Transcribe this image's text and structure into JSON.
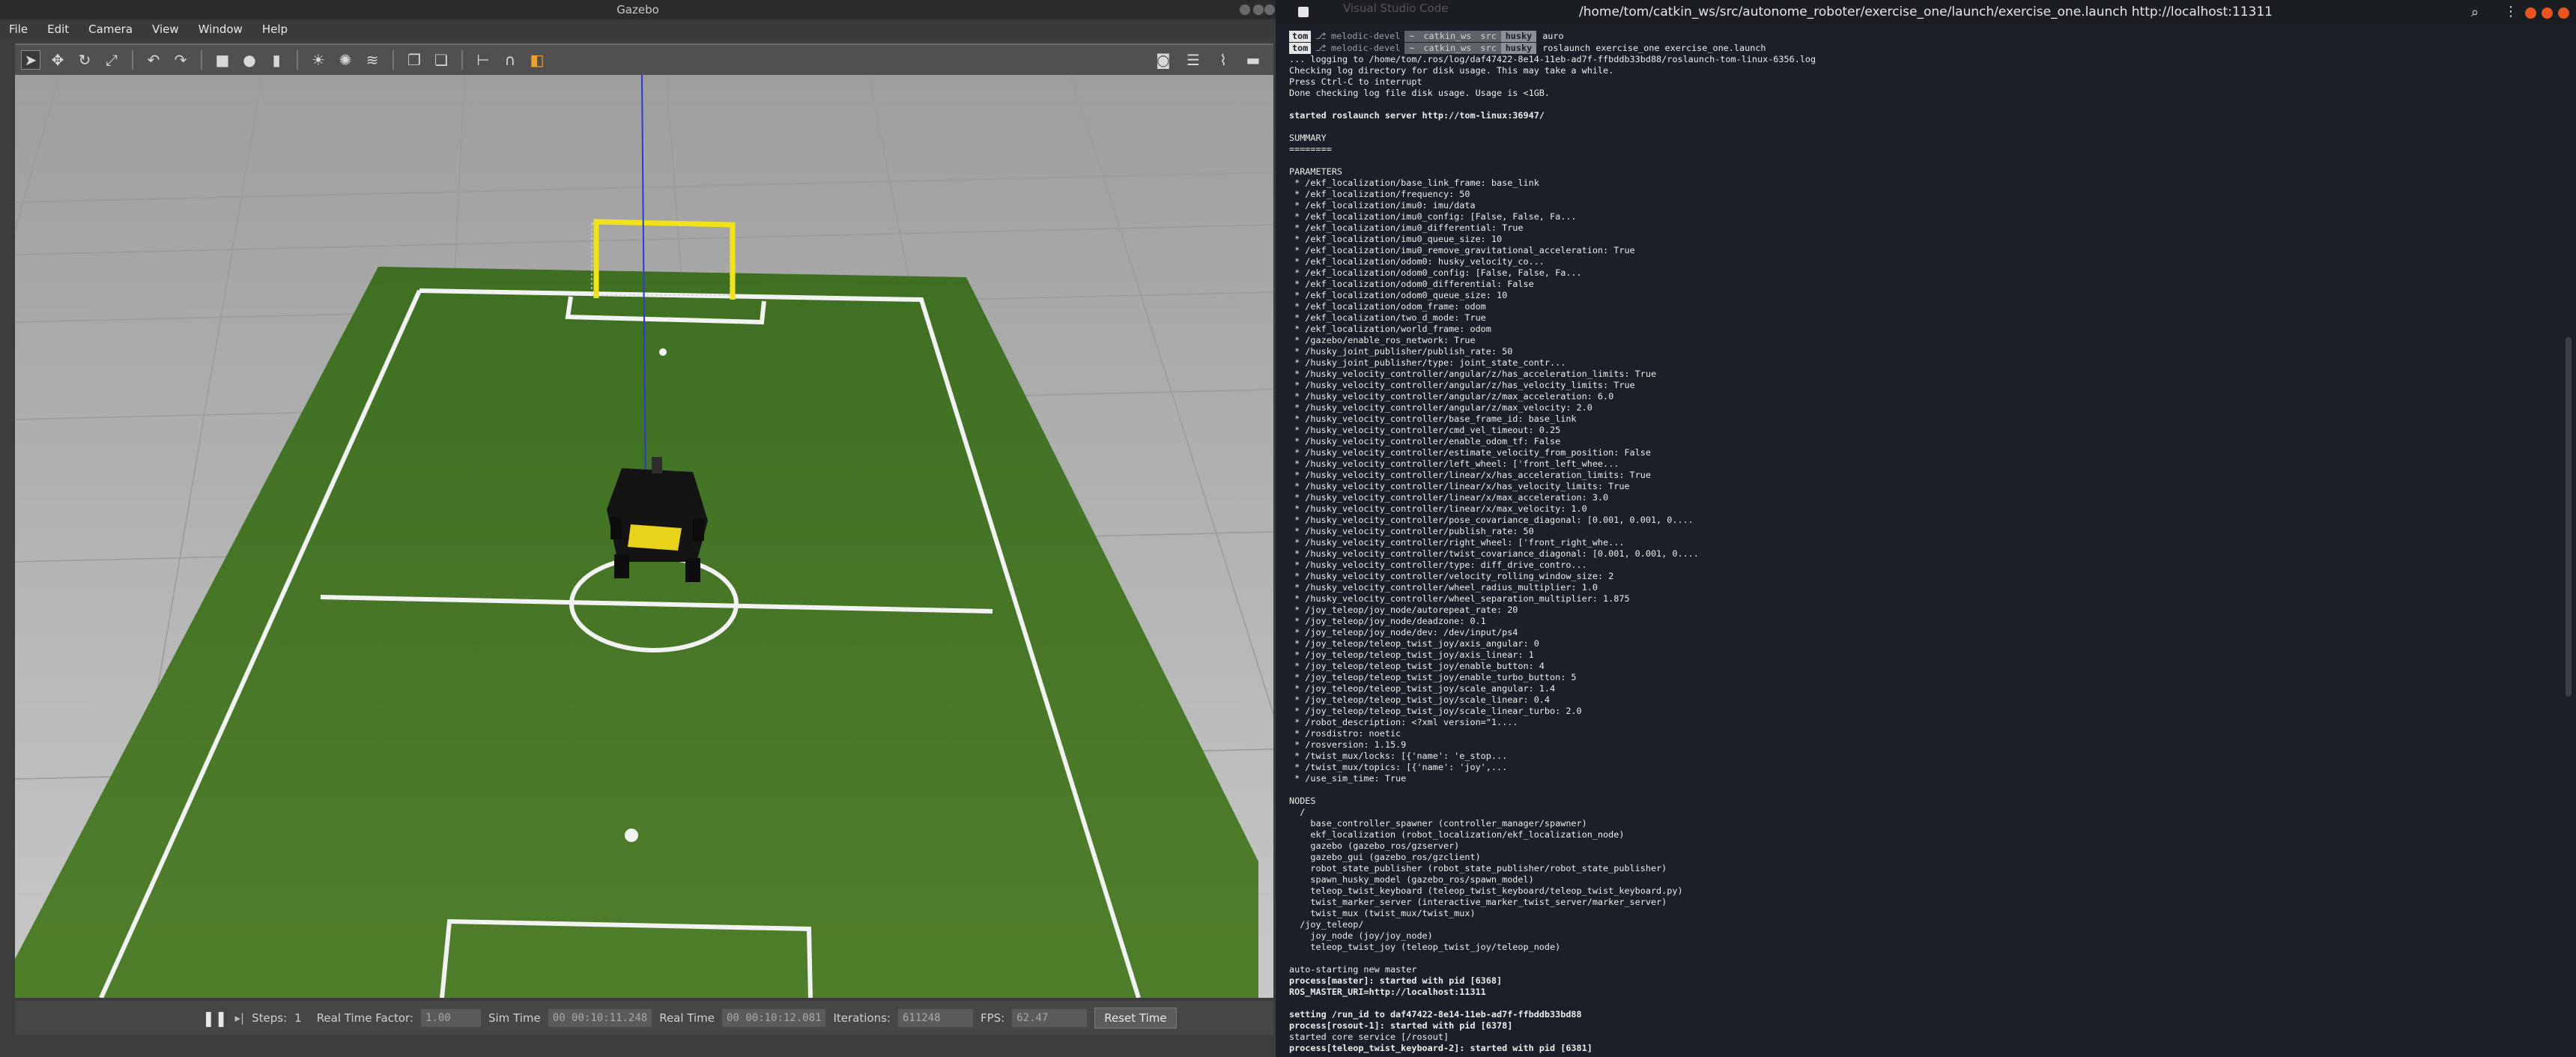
{
  "gazebo": {
    "title": "Gazebo",
    "menu": [
      "File",
      "Edit",
      "Camera",
      "View",
      "Window",
      "Help"
    ],
    "bottom": {
      "steps_label": "Steps:",
      "steps_value": "1",
      "rtf_label": "Real Time Factor:",
      "rtf_value": "1.00",
      "simtime_label": "Sim Time",
      "simtime_value": "00 00:10:11.248",
      "realtime_label": "Real Time",
      "realtime_value": "00 00:10:12.081",
      "iterations_label": "Iterations:",
      "iterations_value": "611248",
      "fps_label": "FPS:",
      "fps_value": "62.47",
      "reset_label": "Reset Time"
    }
  },
  "terminal": {
    "faded_title": "Visual Studio Code",
    "title": "/home/tom/catkin_ws/src/autonome_roboter/exercise_one/launch/exercise_one.launch http://localhost:11311",
    "prompts": [
      {
        "user": "tom",
        "branch": "⎇ melodic-devel",
        "path": [
          "~",
          "catkin_ws",
          "src"
        ],
        "last": "husky",
        "cmd": "auro"
      },
      {
        "user": "tom",
        "branch": "⎇ melodic-devel",
        "path": [
          "~",
          "catkin_ws",
          "src"
        ],
        "last": "husky",
        "cmd": "roslaunch exercise_one exercise_one.launch"
      }
    ],
    "lines": [
      {
        "t": "... logging to /home/tom/.ros/log/daf47422-8e14-11eb-ad7f-ffbddb33bd88/roslaunch-tom-linux-6356.log"
      },
      {
        "t": "Checking log directory for disk usage. This may take a while."
      },
      {
        "t": "Press Ctrl-C to interrupt"
      },
      {
        "t": "Done checking log file disk usage. Usage is <1GB."
      },
      {
        "t": ""
      },
      {
        "t": "started roslaunch server http://tom-linux:36947/",
        "b": true
      },
      {
        "t": ""
      },
      {
        "t": "SUMMARY"
      },
      {
        "t": "========"
      },
      {
        "t": ""
      },
      {
        "t": "PARAMETERS"
      },
      {
        "t": " * /ekf_localization/base_link_frame: base_link"
      },
      {
        "t": " * /ekf_localization/frequency: 50"
      },
      {
        "t": " * /ekf_localization/imu0: imu/data"
      },
      {
        "t": " * /ekf_localization/imu0_config: [False, False, Fa..."
      },
      {
        "t": " * /ekf_localization/imu0_differential: True"
      },
      {
        "t": " * /ekf_localization/imu0_queue_size: 10"
      },
      {
        "t": " * /ekf_localization/imu0_remove_gravitational_acceleration: True"
      },
      {
        "t": " * /ekf_localization/odom0: husky_velocity_co..."
      },
      {
        "t": " * /ekf_localization/odom0_config: [False, False, Fa..."
      },
      {
        "t": " * /ekf_localization/odom0_differential: False"
      },
      {
        "t": " * /ekf_localization/odom0_queue_size: 10"
      },
      {
        "t": " * /ekf_localization/odom_frame: odom"
      },
      {
        "t": " * /ekf_localization/two_d_mode: True"
      },
      {
        "t": " * /ekf_localization/world_frame: odom"
      },
      {
        "t": " * /gazebo/enable_ros_network: True"
      },
      {
        "t": " * /husky_joint_publisher/publish_rate: 50"
      },
      {
        "t": " * /husky_joint_publisher/type: joint_state_contr..."
      },
      {
        "t": " * /husky_velocity_controller/angular/z/has_acceleration_limits: True"
      },
      {
        "t": " * /husky_velocity_controller/angular/z/has_velocity_limits: True"
      },
      {
        "t": " * /husky_velocity_controller/angular/z/max_acceleration: 6.0"
      },
      {
        "t": " * /husky_velocity_controller/angular/z/max_velocity: 2.0"
      },
      {
        "t": " * /husky_velocity_controller/base_frame_id: base_link"
      },
      {
        "t": " * /husky_velocity_controller/cmd_vel_timeout: 0.25"
      },
      {
        "t": " * /husky_velocity_controller/enable_odom_tf: False"
      },
      {
        "t": " * /husky_velocity_controller/estimate_velocity_from_position: False"
      },
      {
        "t": " * /husky_velocity_controller/left_wheel: ['front_left_whee..."
      },
      {
        "t": " * /husky_velocity_controller/linear/x/has_acceleration_limits: True"
      },
      {
        "t": " * /husky_velocity_controller/linear/x/has_velocity_limits: True"
      },
      {
        "t": " * /husky_velocity_controller/linear/x/max_acceleration: 3.0"
      },
      {
        "t": " * /husky_velocity_controller/linear/x/max_velocity: 1.0"
      },
      {
        "t": " * /husky_velocity_controller/pose_covariance_diagonal: [0.001, 0.001, 0...."
      },
      {
        "t": " * /husky_velocity_controller/publish_rate: 50"
      },
      {
        "t": " * /husky_velocity_controller/right_wheel: ['front_right_whe..."
      },
      {
        "t": " * /husky_velocity_controller/twist_covariance_diagonal: [0.001, 0.001, 0...."
      },
      {
        "t": " * /husky_velocity_controller/type: diff_drive_contro..."
      },
      {
        "t": " * /husky_velocity_controller/velocity_rolling_window_size: 2"
      },
      {
        "t": " * /husky_velocity_controller/wheel_radius_multiplier: 1.0"
      },
      {
        "t": " * /husky_velocity_controller/wheel_separation_multiplier: 1.875"
      },
      {
        "t": " * /joy_teleop/joy_node/autorepeat_rate: 20"
      },
      {
        "t": " * /joy_teleop/joy_node/deadzone: 0.1"
      },
      {
        "t": " * /joy_teleop/joy_node/dev: /dev/input/ps4"
      },
      {
        "t": " * /joy_teleop/teleop_twist_joy/axis_angular: 0"
      },
      {
        "t": " * /joy_teleop/teleop_twist_joy/axis_linear: 1"
      },
      {
        "t": " * /joy_teleop/teleop_twist_joy/enable_button: 4"
      },
      {
        "t": " * /joy_teleop/teleop_twist_joy/enable_turbo_button: 5"
      },
      {
        "t": " * /joy_teleop/teleop_twist_joy/scale_angular: 1.4"
      },
      {
        "t": " * /joy_teleop/teleop_twist_joy/scale_linear: 0.4"
      },
      {
        "t": " * /joy_teleop/teleop_twist_joy/scale_linear_turbo: 2.0"
      },
      {
        "t": " * /robot_description: <?xml version=\"1...."
      },
      {
        "t": " * /rosdistro: noetic"
      },
      {
        "t": " * /rosversion: 1.15.9"
      },
      {
        "t": " * /twist_mux/locks: [{'name': 'e_stop..."
      },
      {
        "t": " * /twist_mux/topics: [{'name': 'joy',..."
      },
      {
        "t": " * /use_sim_time: True"
      },
      {
        "t": ""
      },
      {
        "t": "NODES"
      },
      {
        "t": "  /"
      },
      {
        "t": "    base_controller_spawner (controller_manager/spawner)"
      },
      {
        "t": "    ekf_localization (robot_localization/ekf_localization_node)"
      },
      {
        "t": "    gazebo (gazebo_ros/gzserver)"
      },
      {
        "t": "    gazebo_gui (gazebo_ros/gzclient)"
      },
      {
        "t": "    robot_state_publisher (robot_state_publisher/robot_state_publisher)"
      },
      {
        "t": "    spawn_husky_model (gazebo_ros/spawn_model)"
      },
      {
        "t": "    teleop_twist_keyboard (teleop_twist_keyboard/teleop_twist_keyboard.py)"
      },
      {
        "t": "    twist_marker_server (interactive_marker_twist_server/marker_server)"
      },
      {
        "t": "    twist_mux (twist_mux/twist_mux)"
      },
      {
        "t": "  /joy_teleop/"
      },
      {
        "t": "    joy_node (joy/joy_node)"
      },
      {
        "t": "    teleop_twist_joy (teleop_twist_joy/teleop_node)"
      },
      {
        "t": ""
      },
      {
        "t": "auto-starting new master"
      },
      {
        "t": "process[master]: started with pid [6368]",
        "b": true
      },
      {
        "t": "ROS_MASTER_URI=http://localhost:11311",
        "b": true
      },
      {
        "t": ""
      },
      {
        "t": "setting /run_id to daf47422-8e14-11eb-ad7f-ffbddb33bd88",
        "b": true
      },
      {
        "t": "process[rosout-1]: started with pid [6378]",
        "b": true
      },
      {
        "t": "started core service [/rosout]"
      },
      {
        "t": "process[teleop_twist_keyboard-2]: started with pid [6381]",
        "b": true
      }
    ]
  }
}
